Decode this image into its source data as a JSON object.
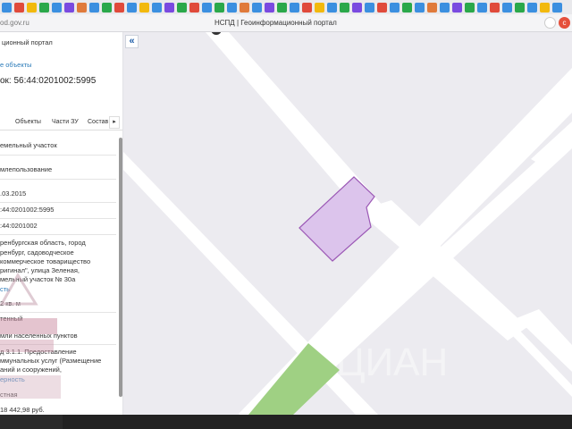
{
  "browser": {
    "url": "od.gov.ru",
    "page_title": "НСПД | Геоинформационный портал",
    "tab_colors": [
      "#3b8fe0",
      "#e04a3b",
      "#f2b90d",
      "#2aa84a",
      "#3b8fe0",
      "#7a4ae0",
      "#e07a3b",
      "#3b8fe0",
      "#2aa84a",
      "#e04a3b",
      "#3b8fe0",
      "#f2b90d",
      "#3b8fe0",
      "#7a4ae0",
      "#2aa84a",
      "#e04a3b",
      "#3b8fe0",
      "#2aa84a",
      "#3b8fe0",
      "#e07a3b",
      "#3b8fe0",
      "#7a4ae0",
      "#2aa84a",
      "#3b8fe0",
      "#e04a3b",
      "#f2b90d",
      "#3b8fe0",
      "#2aa84a",
      "#7a4ae0",
      "#3b8fe0",
      "#e04a3b",
      "#3b8fe0",
      "#2aa84a",
      "#3b8fe0",
      "#e07a3b",
      "#3b8fe0",
      "#7a4ae0",
      "#2aa84a",
      "#3b8fe0",
      "#e04a3b",
      "#3b8fe0",
      "#2aa84a",
      "#3b8fe0",
      "#f2b90d",
      "#3b8fe0"
    ]
  },
  "sidebar": {
    "portal_title": "ционный портал",
    "back_link": "е объекты",
    "cadastral": "ок: 56:44:0201002:5995",
    "tabs": [
      "Объекты",
      "Части ЗУ",
      "Состав"
    ],
    "tab_more": "▸",
    "fields": {
      "type": "емельный участок",
      "kind": "млепользование",
      "date": ".03.2015",
      "cad_number": ":44:0201002:5995",
      "quarter": ":44:0201002",
      "address_lines": [
        "ренбургская область, город",
        "ренбург, садоводческое",
        "коммерческое товарищество",
        "ригинал\", улица Зеленая,",
        "мельный участок № 30а"
      ],
      "area_link": "сть",
      "area": "2 кв. м",
      "status": "тенный",
      "category": "мли населенных пунктов",
      "use_lines": [
        "д 3.1.1. Предоставление",
        "ммунальных услуг (Размещение",
        "аний и сооружений,"
      ],
      "use_link": "ерность",
      "ownership": "стная",
      "cost": "18 442,98 руб."
    }
  },
  "map": {
    "collapse_label": "«",
    "colors": {
      "background": "#ecebf0",
      "block": "#e7e5ed",
      "road": "#ffffff",
      "parcel_fill": "#dcc4ec",
      "parcel_stroke": "#9b58b5",
      "green": "#9fd083"
    }
  },
  "watermark_text": "ЦИАН"
}
